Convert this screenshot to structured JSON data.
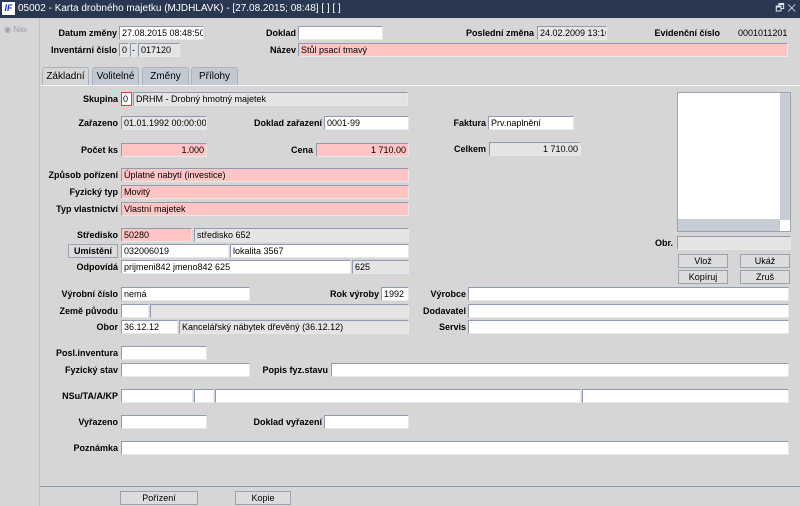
{
  "window": {
    "logo": "IF",
    "title": "05002 - Karta drobného majetku (MJDHLAVK) - [27.08.2015; 08:48] [ ] [ ]",
    "controls": "🗗 ✕"
  },
  "sidebar": {
    "nav": "◉ Nav"
  },
  "header": {
    "datum_zmeny_label": "Datum změny",
    "datum_zmeny": "27.08.2015 08:48:50",
    "doklad_label": "Doklad",
    "doklad": "",
    "posledni_zmena_label": "Poslední změna",
    "posledni_zmena": "24.02.2009 13:16",
    "evidencni_cislo_label": "Evidenční číslo",
    "evidencni_cislo": "0001011201",
    "inventarni_cislo_label": "Inventární číslo",
    "inv_prefix": "0",
    "inv_sep": "-",
    "inv_number": "017120",
    "nazev_label": "Název",
    "nazev": "Stůl psací tmavý"
  },
  "tabs": [
    {
      "label": "Základní",
      "active": true
    },
    {
      "label": "Volitelné"
    },
    {
      "label": "Změny"
    },
    {
      "label": "Přílohy"
    }
  ],
  "form": {
    "skupina_label": "Skupina",
    "skupina_code": "0",
    "skupina_desc": "DRHM - Drobný hmotný majetek",
    "zarazeno_label": "Zařazeno",
    "zarazeno": "01.01.1992 00:00:00",
    "doklad_zarazeni_label": "Doklad zařazení",
    "doklad_zarazeni": "0001-99",
    "faktura_label": "Faktura",
    "faktura": "Prv.naplnění",
    "pocet_label": "Počet ks",
    "pocet": "1.000",
    "cena_label": "Cena",
    "cena": "1 710.00",
    "celkem_label": "Celkem",
    "celkem": "1 710.00",
    "zpusob_label": "Způsob pořízení",
    "zpusob": "Úplatné nabytí (investice)",
    "fyz_typ_label": "Fyzický typ",
    "fyz_typ": "Movitý",
    "typ_vl_label": "Typ vlastnictví",
    "typ_vl": "Vlastní majetek",
    "stredisko_label": "Středisko",
    "stredisko": "50280",
    "stredisko_desc": "středisko 652",
    "umisteni_button": "Umistění",
    "umisteni": "032006019",
    "umisteni_desc": "lokalita 3567",
    "odpovida_label": "Odpovídá",
    "odpovida": "prijmeni842 jmeno842 625",
    "odpovida_code": "625",
    "obr_label": "Obr.",
    "obr": "",
    "vloz": "Vlož",
    "ukaz": "Ukáž",
    "kopiruj": "Kopíruj",
    "zrus": "Zruš",
    "vyrobni_label": "Výrobní číslo",
    "vyrobni": "nemá",
    "rok_label": "Rok výroby",
    "rok": "1992",
    "vyrobce_label": "Výrobce",
    "dodavatel_label": "Dodavatel",
    "servis_label": "Servis",
    "zeme_label": "Země původu",
    "obor_label": "Obor",
    "obor": "36.12.12",
    "obor_desc": "Kancelářský nábytek dřevěný (36.12.12)",
    "posl_inv_label": "Posl.inventura",
    "fyz_stav_label": "Fyzický stav",
    "popis_fyz_label": "Popis fyz.stavu",
    "nsu_label": "NSu/TA/A/KP",
    "vyrazeno_label": "Vyřazeno",
    "doklad_vyrazeni_label": "Doklad vyřazení",
    "poznamka_label": "Poznámka"
  },
  "footer": {
    "porizeni": "Pořízení",
    "kopie": "Kopie"
  }
}
